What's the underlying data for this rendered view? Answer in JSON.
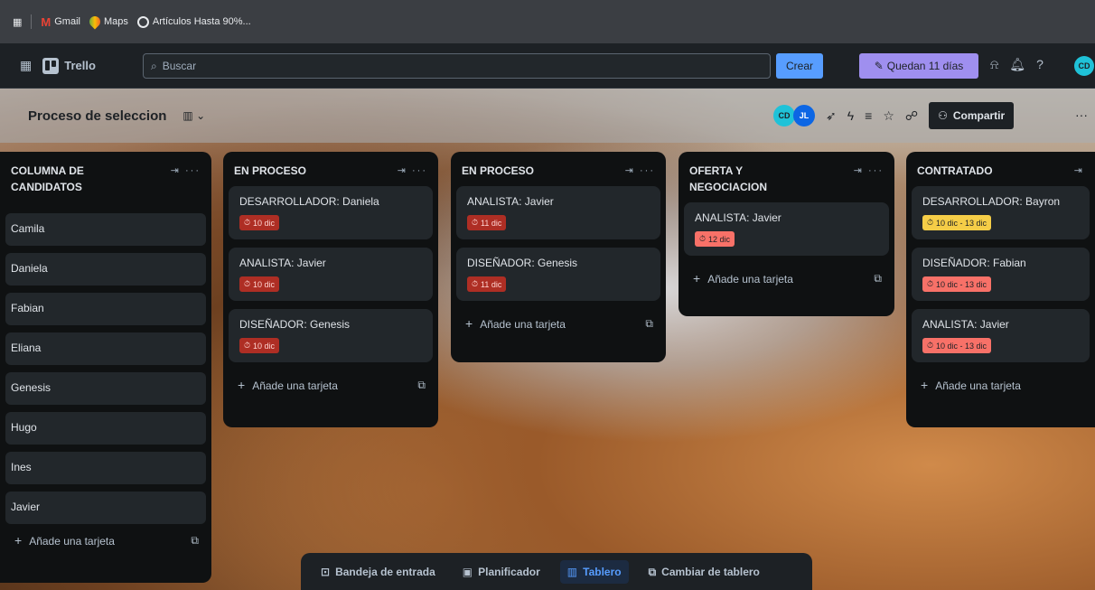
{
  "bookmarks": {
    "items": [
      {
        "label": "Gmail",
        "icon": "gmail-icon"
      },
      {
        "label": "Maps",
        "icon": "maps-icon"
      },
      {
        "label": "Artículos Hasta 90%...",
        "icon": "globe-icon"
      }
    ]
  },
  "topnav": {
    "app_name": "Trello",
    "search_placeholder": "Buscar",
    "create_label": "Crear",
    "trial_label": "Quedan 11 días",
    "user_initials": "CD"
  },
  "board": {
    "title": "Proceso de seleccion",
    "share_label": "Compartir",
    "members": [
      "CD",
      "JL"
    ],
    "lists": [
      {
        "title": "COLUMNA DE CANDIDATOS",
        "cards": [
          "Camila",
          "Daniela",
          "Fabian",
          "Eliana",
          "Genesis",
          "Hugo",
          "Ines",
          "Javier"
        ],
        "add_label": "Añade una tarjeta"
      },
      {
        "title": "EN PROCESO",
        "cards": [
          {
            "title": "DESARROLLADOR: Daniela",
            "date": "10 dic"
          },
          {
            "title": "ANALISTA: Javier",
            "date": "10 dic"
          },
          {
            "title": "DISEÑADOR: Genesis",
            "date": "10 dic"
          }
        ],
        "add_label": "Añade una tarjeta"
      },
      {
        "title": "EN PROCESO",
        "cards": [
          {
            "title": "ANALISTA: Javier",
            "date": "11 dic"
          },
          {
            "title": "DISEÑADOR: Genesis",
            "date": "11 dic"
          }
        ],
        "add_label": "Añade una tarjeta"
      },
      {
        "title": "OFERTA Y NEGOCIACION",
        "cards": [
          {
            "title": "ANALISTA: Javier",
            "date": "12 dic"
          }
        ],
        "add_label": "Añade una tarjeta"
      },
      {
        "title": "CONTRATADO",
        "cards": [
          {
            "title": "DESARROLLADOR: Bayron",
            "date": "10 dic - 13 dic"
          },
          {
            "title": "DISEÑADOR: Fabian",
            "date": "10 dic - 13 dic"
          },
          {
            "title": "ANALISTA: Javier",
            "date": "10 dic - 13 dic"
          }
        ],
        "add_label": "Añade una tarjeta"
      }
    ]
  },
  "switcher": {
    "inbox": "Bandeja de entrada",
    "planner": "Planificador",
    "board": "Tablero",
    "switch": "Cambiar de tablero"
  }
}
